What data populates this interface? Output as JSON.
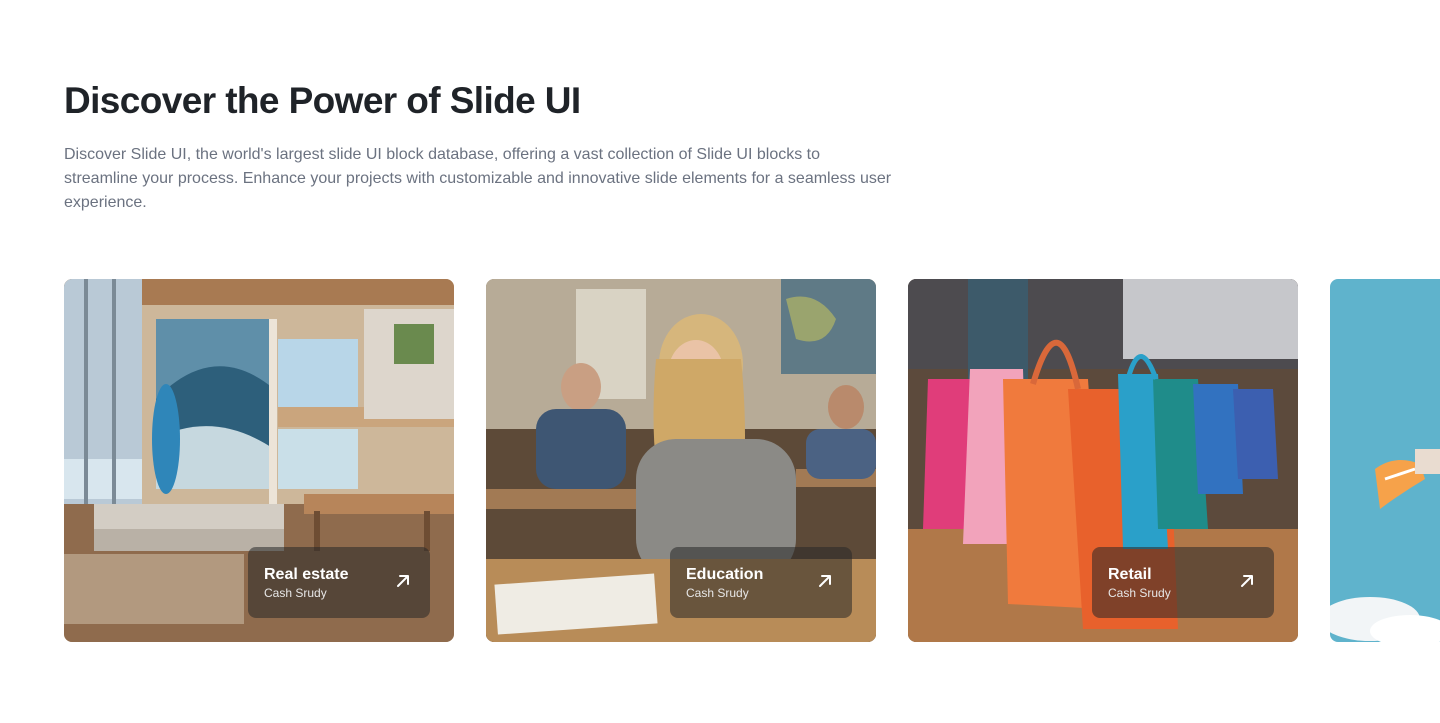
{
  "section": {
    "title": "Discover the Power of Slide UI",
    "description": "Discover Slide UI, the world's largest slide UI block database, offering a vast collection of Slide UI blocks to streamline your process. Enhance your projects with customizable and innovative slide elements for a seamless user experience."
  },
  "cards": [
    {
      "title": "Real estate",
      "subtitle": "Cash Srudy",
      "icon": "arrow-up-right-icon"
    },
    {
      "title": "Education",
      "subtitle": "Cash Srudy",
      "icon": "arrow-up-right-icon"
    },
    {
      "title": "Retail",
      "subtitle": "Cash Srudy",
      "icon": "arrow-up-right-icon"
    }
  ],
  "colors": {
    "heading": "#1f2328",
    "body_text": "#6b7280",
    "caption_overlay": "rgba(40,40,40,0.55)",
    "caption_text": "#ffffff"
  }
}
